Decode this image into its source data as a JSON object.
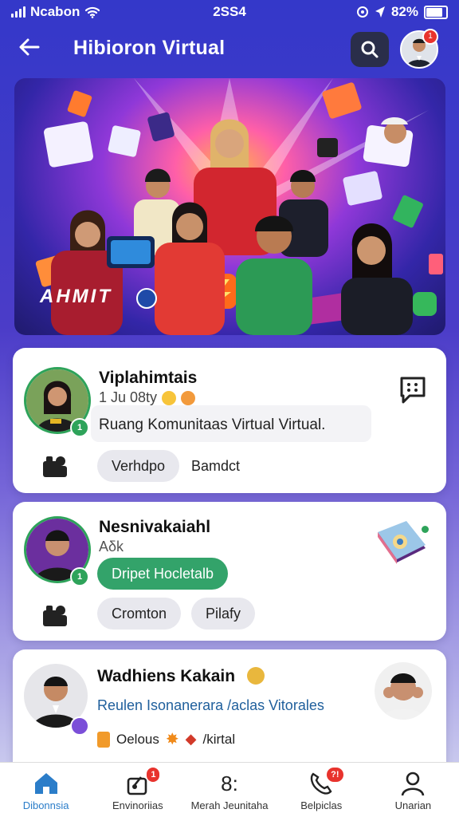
{
  "status": {
    "carrier": "Ncabon",
    "time": "2SS4",
    "battery": "82%"
  },
  "appbar": {
    "title": "Hibioron Virtual",
    "notification_badge": "1"
  },
  "hero": {
    "overlay_text": "AHMIT"
  },
  "cards": [
    {
      "name": "Viplahimtais",
      "time_line": "1 Ju 08ty",
      "message": "Ruang Komunitaas  Virtual Virtual.",
      "chips": [
        "Verhdpo",
        "Bamdct"
      ],
      "online_badge": "1"
    },
    {
      "name": "Nesnivakaiahl",
      "sub": "Aδk",
      "action_label": "Dripet Hocletalb",
      "chips": [
        "Cromton",
        "Pilafy"
      ],
      "online_badge": "1"
    },
    {
      "name": "Wadhiens Kakain",
      "message": "Reulen Isonanerara /aclas Vitorales",
      "tags": "Oelous",
      "tags2": "/kirtal"
    }
  ],
  "tabs": [
    {
      "label": "Dibonnsia",
      "icon": "home-icon",
      "active": true
    },
    {
      "label": "Envinoriias",
      "icon": "share-icon",
      "badge": "1"
    },
    {
      "label": "Merah Jeunitaha",
      "icon": "apps-icon",
      "glyph": "8:"
    },
    {
      "label": "Belpiclas",
      "icon": "phone-chat-icon",
      "badge": "?!"
    },
    {
      "label": "Unarian",
      "icon": "user-icon"
    }
  ],
  "colors": {
    "accent": "#2b7dc9",
    "header_bg": "#3438c9",
    "green": "#33a36a",
    "badge": "#e8332d"
  }
}
